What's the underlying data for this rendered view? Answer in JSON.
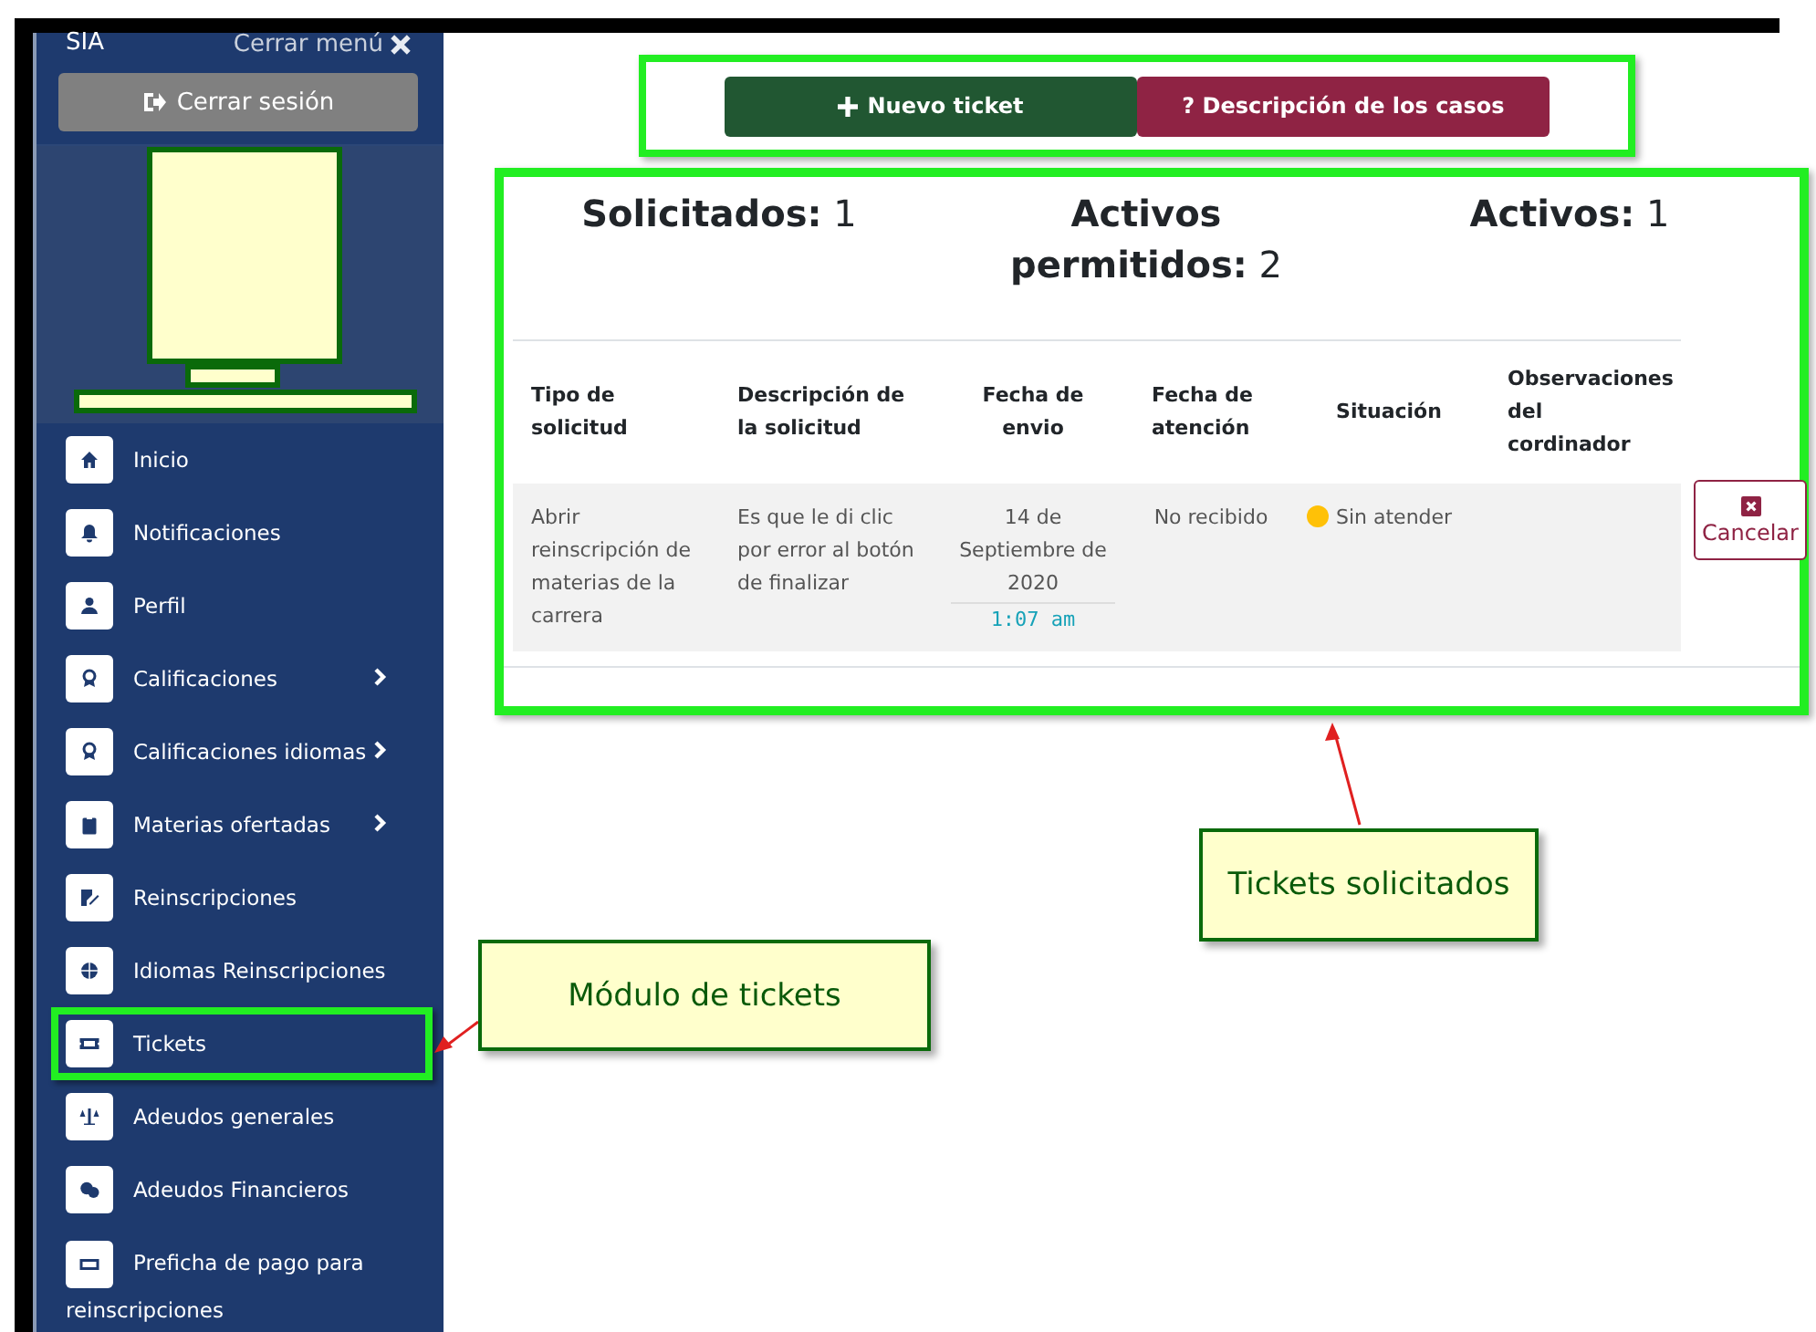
{
  "sidebar": {
    "brand": "SIA",
    "close_menu": "Cerrar menú",
    "logout": "Cerrar sesión",
    "items": [
      {
        "label": "Inicio",
        "submenu": false,
        "outlined": false
      },
      {
        "label": "Notificaciones",
        "submenu": false,
        "outlined": false
      },
      {
        "label": "Perfil",
        "submenu": false,
        "outlined": false
      },
      {
        "label": "Calificaciones",
        "submenu": true,
        "outlined": false
      },
      {
        "label": "Calificaciones idiomas",
        "submenu": true,
        "outlined": false
      },
      {
        "label": "Materias ofertadas",
        "submenu": true,
        "outlined": false
      },
      {
        "label": "Reinscripciones",
        "submenu": false,
        "outlined": false
      },
      {
        "label": "Idiomas Reinscripciones",
        "submenu": false,
        "outlined": false
      },
      {
        "label": "Tickets",
        "submenu": false,
        "outlined": true
      },
      {
        "label": "Adeudos generales",
        "submenu": false,
        "outlined": false
      },
      {
        "label": "Adeudos Financieros",
        "submenu": false,
        "outlined": false
      },
      {
        "label": "Preficha de pago para reinscripciones",
        "submenu": false,
        "outlined": false
      }
    ]
  },
  "actions": [
    {
      "label": "Nuevo ticket",
      "kind": "primary"
    },
    {
      "label": "? Descripción de los casos",
      "kind": "info"
    }
  ],
  "stats": [
    {
      "label": "Solicitados:",
      "value": "1"
    },
    {
      "label": "Activos permitidos:",
      "value": "2"
    },
    {
      "label": "Activos:",
      "value": "1"
    }
  ],
  "table": {
    "columns": [
      "Tipo de solicitud",
      "Descripción de la solicitud",
      "Fecha de envio",
      "Fecha de atención",
      "Situación",
      "Observaciones del cordinador"
    ],
    "rows": [
      {
        "type": "Abrir reinscripción de materias de la carrera",
        "description": "Es que le di clic por error al botón de finalizar",
        "sent_date": "14 de Septiembre de 2020",
        "sent_time": "1:07 am",
        "attended": "No recibido",
        "status": "Sin atender",
        "color": "#ffc107",
        "action": "Cancelar"
      }
    ]
  },
  "callouts": [
    {
      "text": "Tickets solicitados"
    },
    {
      "text": "Módulo de tickets"
    }
  ]
}
